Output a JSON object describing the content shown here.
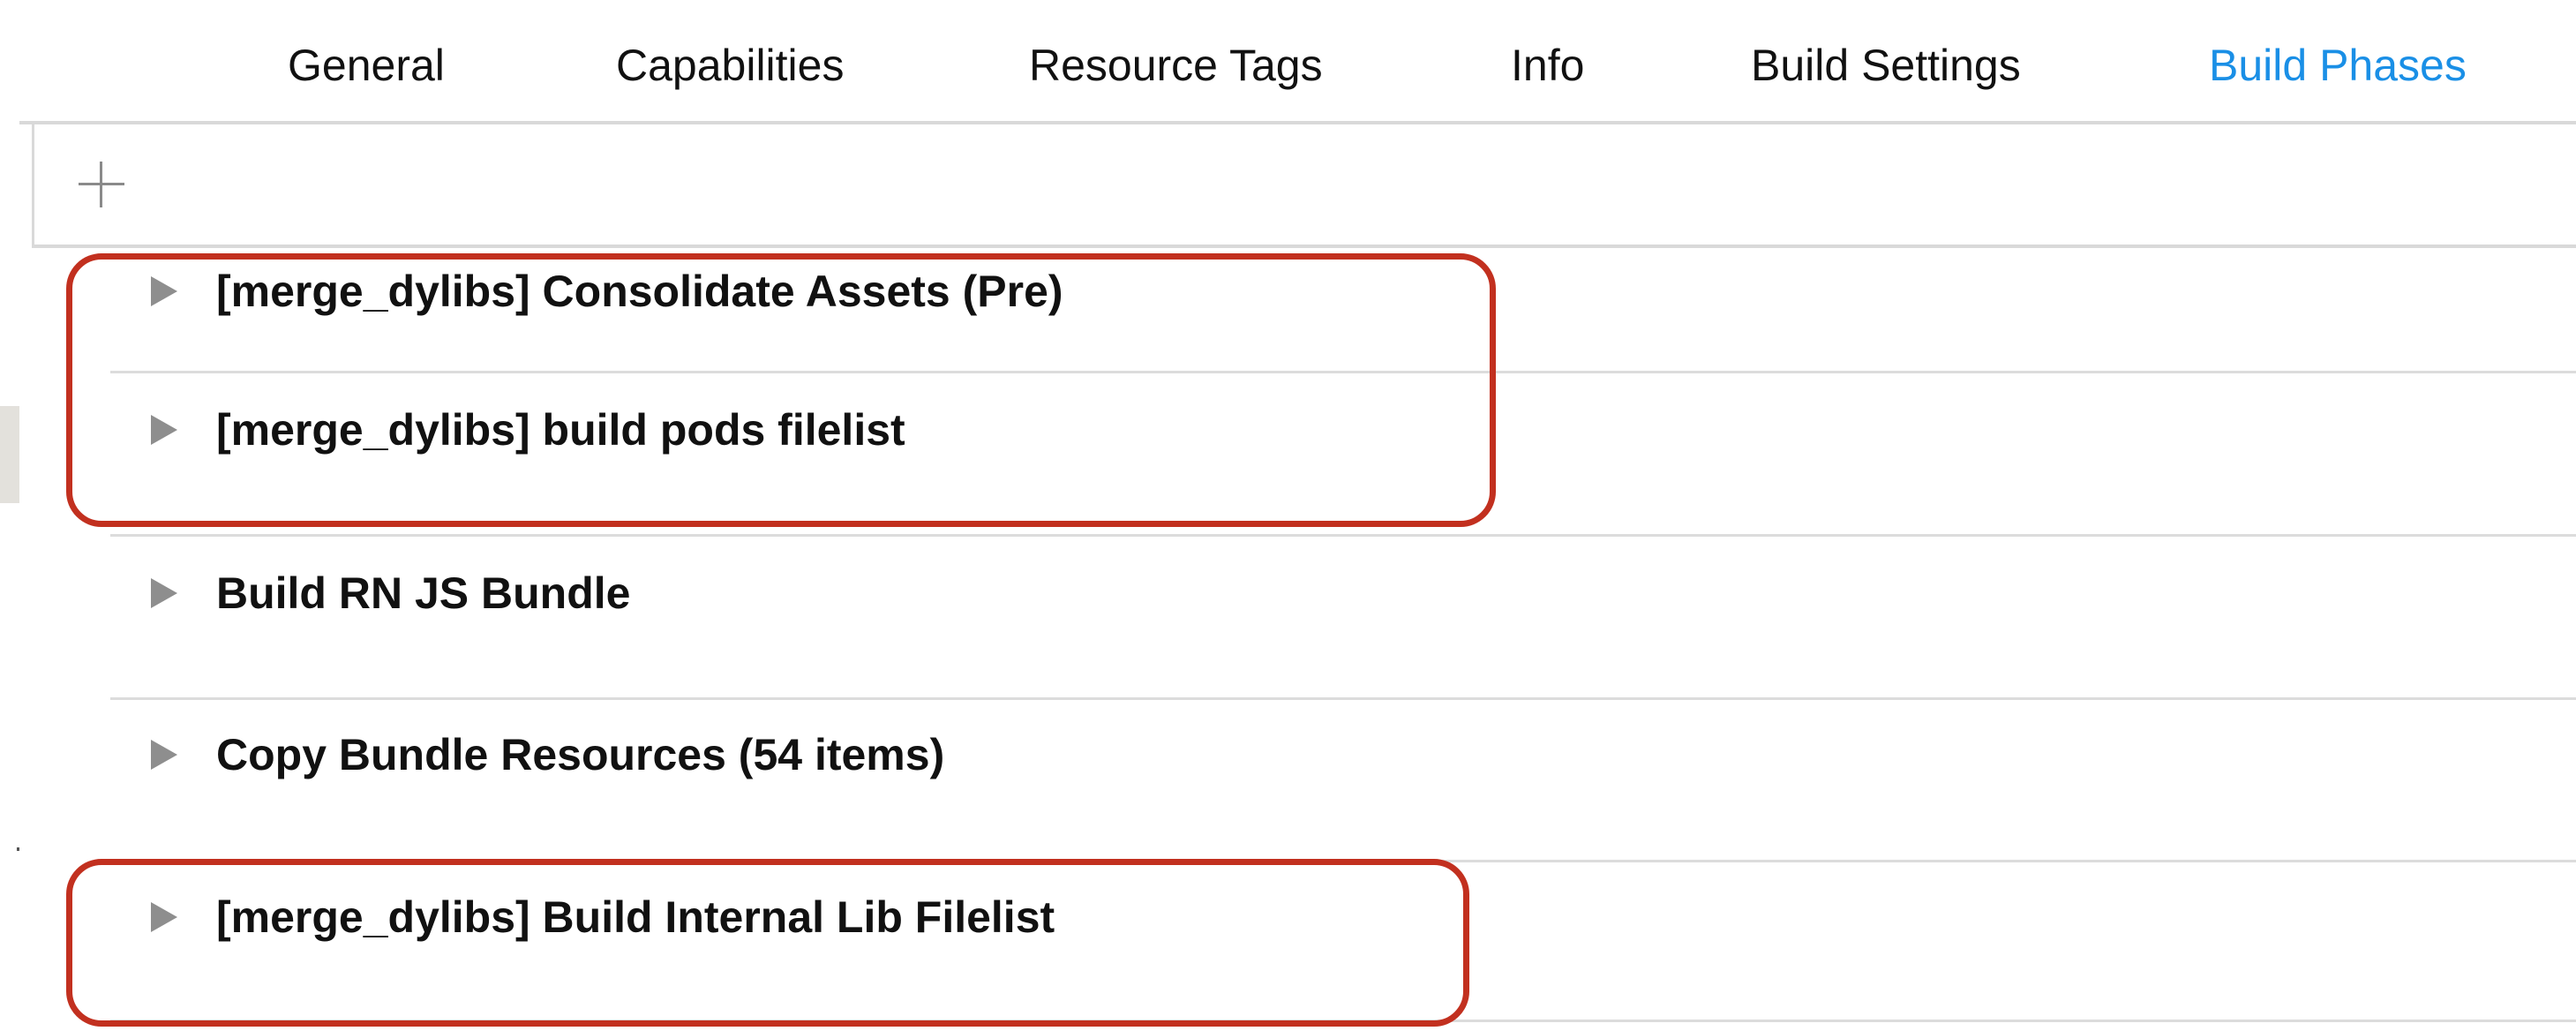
{
  "tabs": [
    {
      "label": "General",
      "active": false
    },
    {
      "label": "Capabilities",
      "active": false
    },
    {
      "label": "Resource Tags",
      "active": false
    },
    {
      "label": "Info",
      "active": false
    },
    {
      "label": "Build Settings",
      "active": false
    },
    {
      "label": "Build Phases",
      "active": true
    }
  ],
  "toolbar": {
    "add_icon": "plus-icon"
  },
  "phases": [
    {
      "label": "[merge_dylibs] Consolidate Assets (Pre)",
      "highlighted": true
    },
    {
      "label": "[merge_dylibs] build pods filelist",
      "highlighted": true
    },
    {
      "label": "Build RN JS Bundle",
      "highlighted": false
    },
    {
      "label": "Copy Bundle Resources (54 items)",
      "highlighted": false
    },
    {
      "label": "[merge_dylibs] Build Internal Lib Filelist",
      "highlighted": true
    }
  ],
  "colors": {
    "active_tab": "#1a8fe6",
    "highlight": "#c2301f",
    "disclosure": "#8e8e8e"
  }
}
